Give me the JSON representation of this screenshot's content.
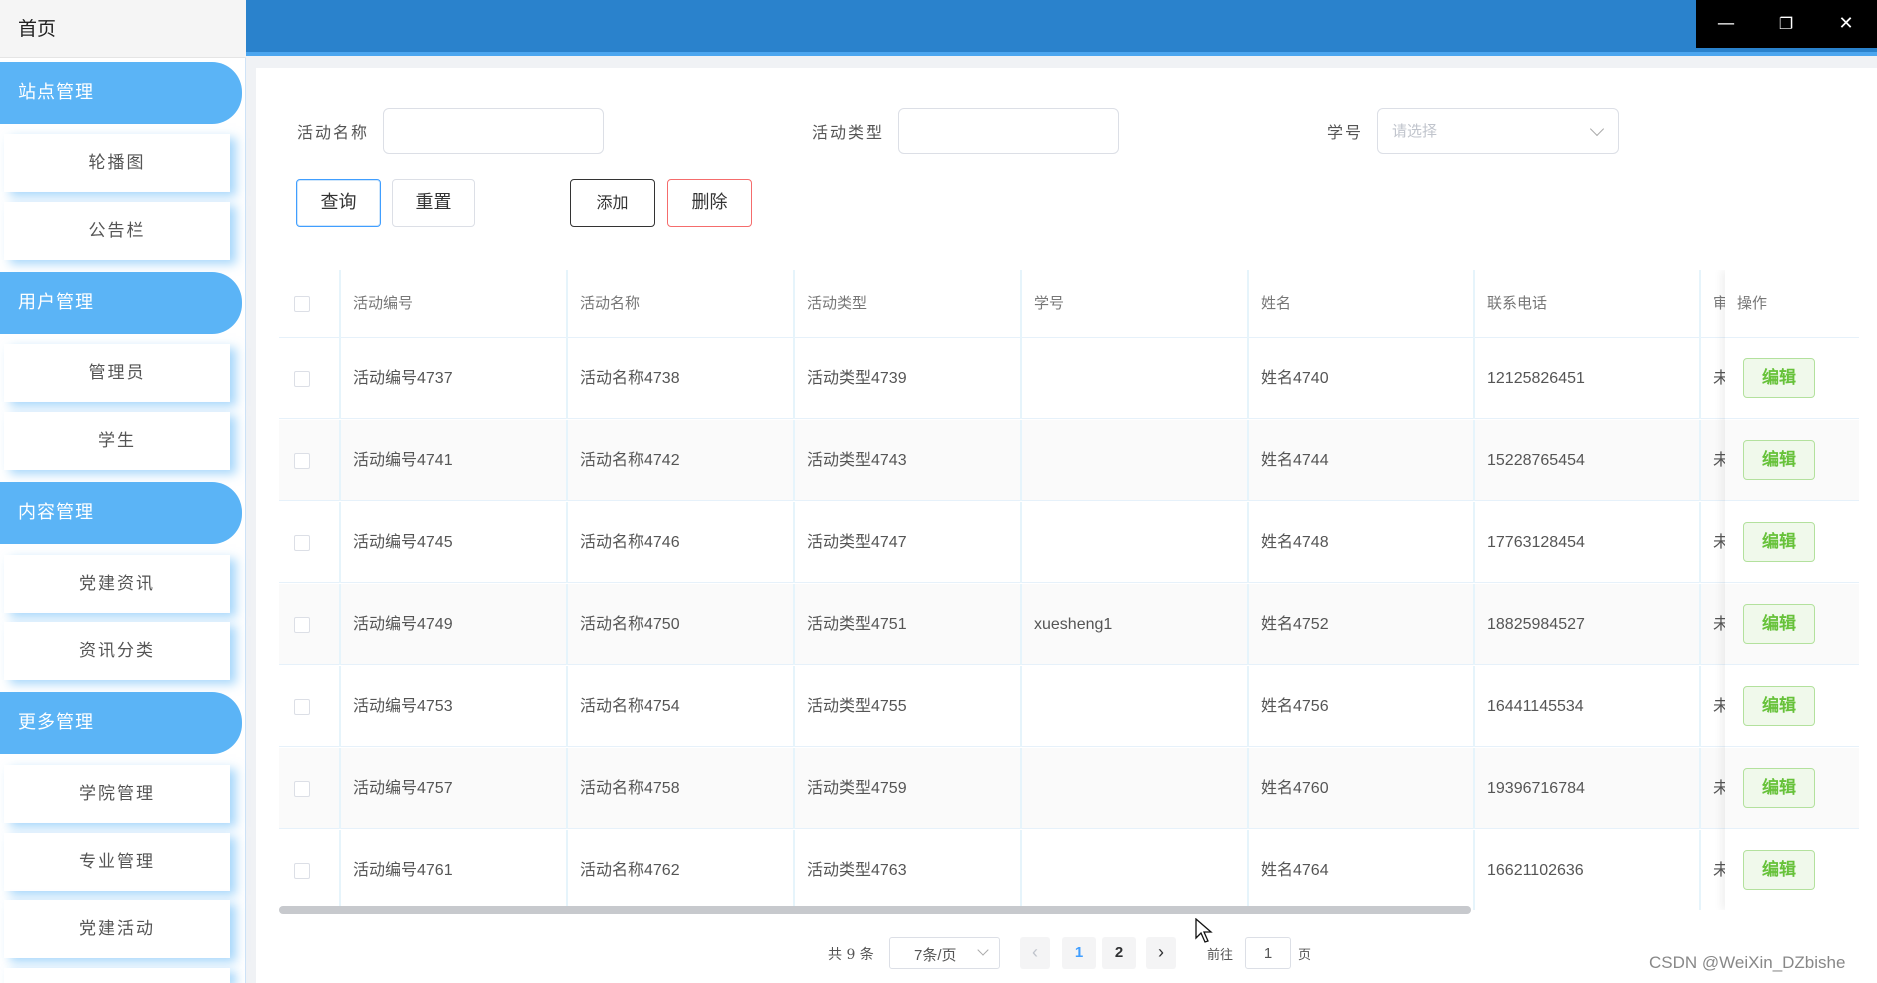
{
  "sidebar": {
    "home": "首页",
    "groups": [
      {
        "label": "站点管理",
        "items": [
          "轮播图",
          "公告栏"
        ]
      },
      {
        "label": "用户管理",
        "items": [
          "管理员",
          "学生"
        ]
      },
      {
        "label": "内容管理",
        "items": [
          "党建资讯",
          "资讯分类"
        ]
      },
      {
        "label": "更多管理",
        "items": [
          "学院管理",
          "专业管理",
          "党建活动"
        ]
      }
    ]
  },
  "window": {
    "minimize": "—",
    "restore": "❐",
    "close": "✕"
  },
  "search": {
    "name_label": "活动名称",
    "type_label": "活动类型",
    "student_label": "学号",
    "student_placeholder": "请选择",
    "query_button": "查询",
    "reset_button": "重置",
    "add_button": "添加",
    "delete_button": "删除"
  },
  "table": {
    "columns": [
      "活动编号",
      "活动名称",
      "活动类型",
      "学号",
      "姓名",
      "联系电话",
      "审",
      "操作"
    ],
    "edit_label": "编辑",
    "rows": [
      {
        "id": "活动编号4737",
        "name": "活动名称4738",
        "type": "活动类型4739",
        "student": "",
        "person": "姓名4740",
        "phone": "12125826451",
        "status": "未"
      },
      {
        "id": "活动编号4741",
        "name": "活动名称4742",
        "type": "活动类型4743",
        "student": "",
        "person": "姓名4744",
        "phone": "15228765454",
        "status": "未"
      },
      {
        "id": "活动编号4745",
        "name": "活动名称4746",
        "type": "活动类型4747",
        "student": "",
        "person": "姓名4748",
        "phone": "17763128454",
        "status": "未"
      },
      {
        "id": "活动编号4749",
        "name": "活动名称4750",
        "type": "活动类型4751",
        "student": "xuesheng1",
        "person": "姓名4752",
        "phone": "18825984527",
        "status": "未"
      },
      {
        "id": "活动编号4753",
        "name": "活动名称4754",
        "type": "活动类型4755",
        "student": "",
        "person": "姓名4756",
        "phone": "16441145534",
        "status": "未"
      },
      {
        "id": "活动编号4757",
        "name": "活动名称4758",
        "type": "活动类型4759",
        "student": "",
        "person": "姓名4760",
        "phone": "19396716784",
        "status": "未"
      },
      {
        "id": "活动编号4761",
        "name": "活动名称4762",
        "type": "活动类型4763",
        "student": "",
        "person": "姓名4764",
        "phone": "16621102636",
        "status": "未"
      }
    ]
  },
  "pagination": {
    "total": "共 9 条",
    "page_size": "7条/页",
    "pages": [
      "1",
      "2"
    ],
    "current_page": "1",
    "goto_label": "前往",
    "goto_value": "1",
    "page_suffix": "页"
  },
  "watermark": "CSDN @WeiXin_DZbishe",
  "colors": {
    "sidebar_header": "#5bb4f6",
    "topbar": "#2a82cc",
    "edit_green": "#67c23a",
    "delete_red": "#f56c6c",
    "active_page": "#409eff"
  }
}
